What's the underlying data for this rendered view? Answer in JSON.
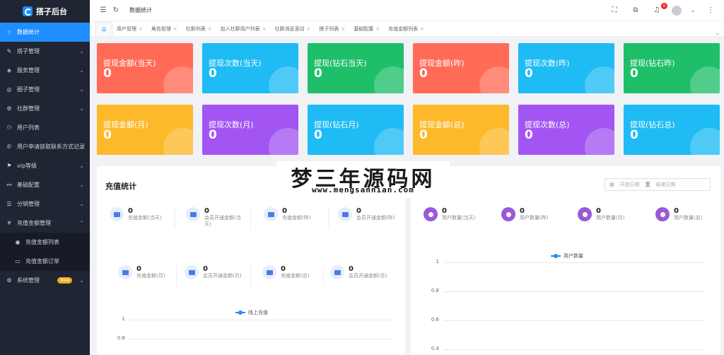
{
  "app": {
    "title": "搭子后台"
  },
  "sidebar": {
    "items": [
      {
        "icon": "star-icon",
        "glyph": "☆",
        "label": "数据统计",
        "active": true,
        "arrow": ""
      },
      {
        "icon": "pen-icon",
        "glyph": "✎",
        "label": "搭子管理",
        "arrow": "⌄"
      },
      {
        "icon": "cube-icon",
        "glyph": "◈",
        "label": "服务管理",
        "arrow": "⌄"
      },
      {
        "icon": "circle-icon",
        "glyph": "◎",
        "label": "圈子管理",
        "arrow": "⌄"
      },
      {
        "icon": "gear-icon",
        "glyph": "⚙",
        "label": "社群管理",
        "arrow": "⌄"
      },
      {
        "icon": "user-icon",
        "glyph": "⚇",
        "label": "用户列表",
        "arrow": ""
      },
      {
        "icon": "phone-icon",
        "glyph": "✆",
        "label": "用户申请获取联系方式记录",
        "arrow": ""
      },
      {
        "icon": "tag-icon",
        "glyph": "⚑",
        "label": "vip等级",
        "arrow": "⌄"
      },
      {
        "icon": "link-icon",
        "glyph": "⚯",
        "label": "基础配置",
        "arrow": "⌄"
      },
      {
        "icon": "list-icon",
        "glyph": "☰",
        "label": "分销管理",
        "arrow": "⌄"
      },
      {
        "icon": "yen-icon",
        "glyph": "¥",
        "label": "充值金额管理",
        "arrow": "⌃"
      },
      {
        "icon": "dot-icon",
        "glyph": "◉",
        "label": "充值金额列表",
        "sub": true,
        "arrow": ""
      },
      {
        "icon": "doc-icon",
        "glyph": "▭",
        "label": "充值金额订单",
        "sub": true,
        "arrow": ""
      },
      {
        "icon": "settings-icon",
        "glyph": "⚙",
        "label": "系统管理",
        "badge": "New",
        "arrow": "⌄"
      }
    ]
  },
  "topbar": {
    "breadcrumb": "数据统计",
    "notification_count": "0"
  },
  "tabs": [
    "用户管理",
    "角色管理",
    "社群列表",
    "加入社群用户列表",
    "社群消息滚动",
    "搭子列表",
    "基础配置",
    "充值金额列表"
  ],
  "cards": [
    {
      "title": "提现金额(当天)",
      "value": "0",
      "color": "#ff6b57"
    },
    {
      "title": "提现次数(当天)",
      "value": "0",
      "color": "#1ebbf5"
    },
    {
      "title": "提现(钻石当天)",
      "value": "0",
      "color": "#1fbf6a"
    },
    {
      "title": "提现金额(昨)",
      "value": "0",
      "color": "#ff6b57"
    },
    {
      "title": "提现次数(昨)",
      "value": "0",
      "color": "#1ebbf5"
    },
    {
      "title": "提现(钻石昨)",
      "value": "0",
      "color": "#1fbf6a"
    },
    {
      "title": "提现金额(月)",
      "value": "0",
      "color": "#fdb92a"
    },
    {
      "title": "提现次数(月)",
      "value": "0",
      "color": "#a355f3"
    },
    {
      "title": "提现(钻石月)",
      "value": "0",
      "color": "#1ebbf5"
    },
    {
      "title": "提现金额(总)",
      "value": "0",
      "color": "#fdb92a"
    },
    {
      "title": "提现次数(总)",
      "value": "0",
      "color": "#a355f3"
    },
    {
      "title": "提现(钻石总)",
      "value": "0",
      "color": "#1ebbf5"
    }
  ],
  "recharge": {
    "title": "充值统计",
    "stats_row1": [
      {
        "value": "0",
        "label": "充值金额(当天)"
      },
      {
        "value": "0",
        "label": "会员开通金额(当天)"
      },
      {
        "value": "0",
        "label": "充值金额(昨)"
      },
      {
        "value": "0",
        "label": "会员开通金额(昨)"
      }
    ],
    "stats_row2": [
      {
        "value": "0",
        "label": "充值金额(月)"
      },
      {
        "value": "0",
        "label": "会员开通金额(月)"
      },
      {
        "value": "0",
        "label": "充值金额(总)"
      },
      {
        "value": "0",
        "label": "会员开通金额(总)"
      }
    ],
    "legend": "线上充值",
    "yticks": [
      "1",
      "0.8"
    ]
  },
  "users": {
    "title_suffix": "计",
    "date_start": "开始日期",
    "date_sep": "至",
    "date_end": "结束日期",
    "stats": [
      {
        "value": "0",
        "label": "用户数量(当天)"
      },
      {
        "value": "0",
        "label": "用户数量(昨)"
      },
      {
        "value": "0",
        "label": "用户数量(月)"
      },
      {
        "value": "0",
        "label": "用户数量(总)"
      }
    ],
    "legend": "用户数量",
    "yticks": [
      "1",
      "0.8",
      "0.6",
      "0.4"
    ]
  },
  "watermark": {
    "title": "梦三年源码网",
    "url": "www.mengsannian.com"
  }
}
